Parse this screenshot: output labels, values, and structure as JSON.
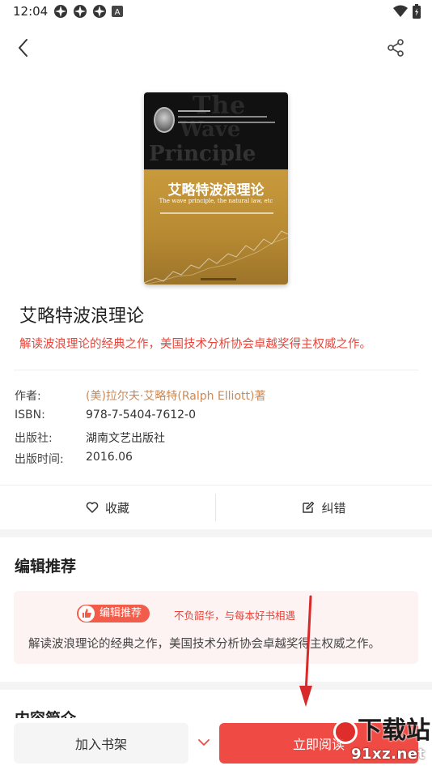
{
  "status_bar": {
    "time": "12:04",
    "icons_left": [
      "app-notification-icon",
      "app-notification-icon",
      "app-notification-icon",
      "a-box-icon"
    ],
    "icons_right": [
      "wifi-icon",
      "battery-icon"
    ]
  },
  "nav": {
    "back_icon": "chevron-left-icon",
    "share_icon": "share-icon"
  },
  "cover": {
    "big_text_1": "The",
    "big_text_2": "Wave",
    "big_text_3": "Principle",
    "title": "艾略特波浪理论",
    "subtitle": "The wave principle, the natural law, etc"
  },
  "book": {
    "title": "艾略特波浪理论",
    "tagline": "解读波浪理论的经典之作，美国技术分析协会卓越奖得主权威之作。"
  },
  "info": {
    "rows": [
      {
        "label": "作者:",
        "value": "(美)拉尔夫·艾略特(Ralph Elliott)著"
      },
      {
        "label": "ISBN:",
        "value": "978-7-5404-7612-0"
      },
      {
        "label": "出版社:",
        "value": "湖南文艺出版社"
      },
      {
        "label": "出版时间:",
        "value": "2016.06"
      }
    ]
  },
  "actions": {
    "favorite_label": "收藏",
    "report_error_label": "纠错"
  },
  "recommend": {
    "section_title": "编辑推荐",
    "badge_label": "编辑推荐",
    "slogan": "不负韶华，与每本好书相遇",
    "text": "解读波浪理论的经典之作，美国技术分析协会卓越奖得主权威之作。"
  },
  "intro": {
    "section_title": "内容简介"
  },
  "bottom": {
    "add_shelf_label": "加入书架",
    "read_now_label": "立即阅读"
  },
  "watermark": {
    "text1": "下载站",
    "text2": "91xz.net"
  },
  "colors": {
    "accent": "#ef4a43",
    "tagline": "#e8443a",
    "author": "#c98a5a"
  }
}
